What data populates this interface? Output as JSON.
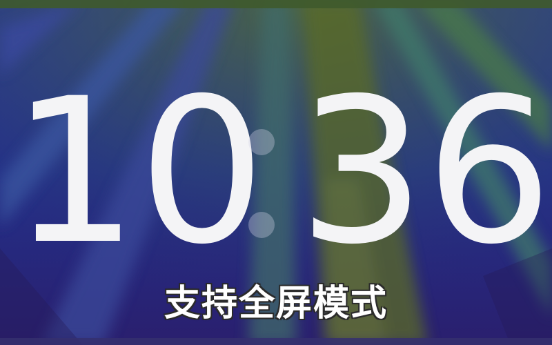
{
  "clock": {
    "hours": "10",
    "minutes": "36"
  },
  "caption": "支持全屏模式",
  "colors": {
    "digit": "#f4f4f6",
    "background_base": "#262a86",
    "background_ray": "#5a6a2a",
    "caption": "#ffffff"
  }
}
